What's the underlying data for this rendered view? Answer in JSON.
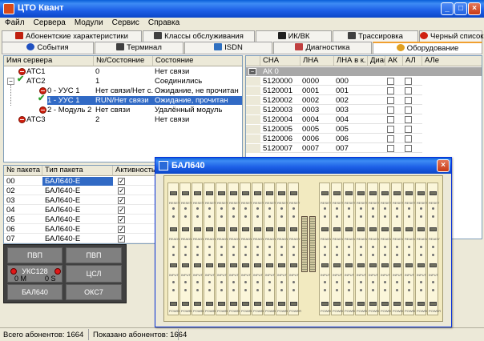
{
  "window": {
    "title": "ЦТО Квант"
  },
  "menu": [
    "Файл",
    "Сервера",
    "Модули",
    "Сервис",
    "Справка"
  ],
  "tabs_row1": [
    {
      "label": "Абонентские характеристики",
      "icon": "phone-icon"
    },
    {
      "label": "Классы обслуживания",
      "icon": "grid-icon"
    },
    {
      "label": "ИК/ВК",
      "icon": "cable-icon"
    },
    {
      "label": "Трассировка",
      "icon": "magnifier-icon"
    },
    {
      "label": "Черный список",
      "icon": "forbidden-icon"
    }
  ],
  "tabs_row2": [
    {
      "label": "События",
      "icon": "info-icon"
    },
    {
      "label": "Терминал",
      "icon": "terminal-icon"
    },
    {
      "label": "ISDN",
      "icon": "isdn-icon"
    },
    {
      "label": "Диагностика",
      "icon": "check-icon"
    },
    {
      "label": "Оборудование",
      "icon": "sun-icon",
      "selected": true
    }
  ],
  "servers": {
    "headers": [
      "Имя сервера",
      "№/Состояние",
      "Состояние"
    ],
    "rows": [
      {
        "name": "АТС1",
        "num": "0",
        "state": "Нет связи",
        "indent": 0,
        "icon": "red",
        "expander": ""
      },
      {
        "name": "АТС2",
        "num": "1",
        "state": "Соединились",
        "indent": 0,
        "icon": "check",
        "expander": "−"
      },
      {
        "name": "0 - УУС 1",
        "num": "Нет связи/Нет с...",
        "state": "Ожидание, не прочитан",
        "indent": 1,
        "icon": "red",
        "expander": ""
      },
      {
        "name": "1 - УУС 1",
        "num": "RUN/Нет связи",
        "state": "Ожидание, прочитан",
        "indent": 1,
        "icon": "check",
        "expander": "",
        "selected": true
      },
      {
        "name": "2 - Модуль 2",
        "num": "Нет связи",
        "state": "Удалённый модуль",
        "indent": 1,
        "icon": "red",
        "expander": ""
      },
      {
        "name": "АТС3",
        "num": "2",
        "state": "Нет связи",
        "indent": 0,
        "icon": "red",
        "expander": ""
      }
    ]
  },
  "packets": {
    "headers": [
      "№ пакета",
      "Тип пакета",
      "Активность"
    ],
    "rows": [
      {
        "num": "00",
        "type": "БАЛ640-Е",
        "active": true,
        "selected": true
      },
      {
        "num": "02",
        "type": "БАЛ640-Е",
        "active": true
      },
      {
        "num": "03",
        "type": "БАЛ640-Е",
        "active": true
      },
      {
        "num": "04",
        "type": "БАЛ640-Е",
        "active": true
      },
      {
        "num": "05",
        "type": "БАЛ640-Е",
        "active": true
      },
      {
        "num": "06",
        "type": "БАЛ640-Е",
        "active": true
      },
      {
        "num": "07",
        "type": "БАЛ640-Е",
        "active": true
      }
    ]
  },
  "hardware": {
    "pvp1": "ПВП",
    "pvp2": "ПВП",
    "uks": "УКС128",
    "uks_left": "0 М",
    "uks_right": "0 S",
    "csl": "ЦСЛ",
    "bal": "БАЛ640",
    "oks": "ОКС7"
  },
  "subscribers": {
    "headers": [
      "СНА",
      "ЛНА",
      "ЛНА в к.",
      "Диаг",
      "АК",
      "АЛ",
      "АЛе"
    ],
    "group": "АК 0",
    "rows": [
      {
        "sna": "5120000",
        "lna": "0000",
        "lnak": "000"
      },
      {
        "sna": "5120001",
        "lna": "0001",
        "lnak": "001"
      },
      {
        "sna": "5120002",
        "lna": "0002",
        "lnak": "002"
      },
      {
        "sna": "5120003",
        "lna": "0003",
        "lnak": "003"
      },
      {
        "sna": "5120004",
        "lna": "0004",
        "lnak": "004"
      },
      {
        "sna": "5120005",
        "lna": "0005",
        "lnak": "005"
      },
      {
        "sna": "5120006",
        "lna": "0006",
        "lnak": "006"
      },
      {
        "sna": "5120007",
        "lna": "0007",
        "lnak": "007"
      }
    ]
  },
  "child_window": {
    "title": "БАЛ640",
    "card_labels": [
      "RESET",
      "READY",
      "INPUT",
      "POWER"
    ]
  },
  "status": {
    "total": "Всего абонентов: 1664",
    "shown": "Показано абонентов: 1664"
  },
  "colors": {
    "titlebar": "#1c5ee6",
    "selection": "#316ac5",
    "rack": "#f2eac0"
  }
}
